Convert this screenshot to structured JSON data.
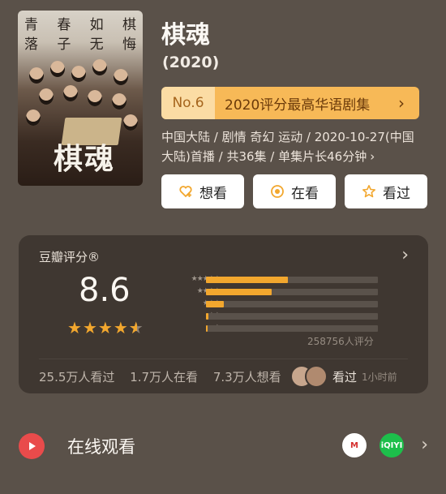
{
  "poster": {
    "poem": [
      [
        "青",
        "春",
        "如",
        "棋"
      ],
      [
        "落",
        "子",
        "无",
        "悔"
      ]
    ],
    "title_art": "棋魂"
  },
  "header": {
    "title": "棋魂",
    "year": "(2020)"
  },
  "ranking": {
    "number": "No.6",
    "text": "2020评分最高华语剧集",
    "chevron": "›"
  },
  "meta": {
    "text": "中国大陆 / 剧情 奇幻 运动 / 2020-10-27(中国大陆)首播 / 共36集 / 单集片长46分钟",
    "chevron": "›"
  },
  "actions": [
    {
      "label": "想看",
      "icon": "heart-plus-icon"
    },
    {
      "label": "在看",
      "icon": "target-circle-icon"
    },
    {
      "label": "看过",
      "icon": "star-outline-icon"
    }
  ],
  "rating": {
    "label": "豆瓣评分®",
    "score": "8.6",
    "stars": 4.3,
    "distribution": [
      {
        "stars": "★★★★★",
        "percent": 47.8
      },
      {
        "stars": "★★★★",
        "percent": 38.0
      },
      {
        "stars": "★★★",
        "percent": 10.5
      },
      {
        "stars": "★★",
        "percent": 1.5
      },
      {
        "stars": "★",
        "percent": 1.0
      }
    ],
    "count": "258756人评分",
    "chevron": "›"
  },
  "stats": {
    "watched": "25.5万人看过",
    "watching": "1.7万人在看",
    "want": "7.3万人想看",
    "friends_seen": "看过",
    "friends_time": "1小时前"
  },
  "watch_online": {
    "label": "在线观看",
    "apps": [
      {
        "icon": "mango-tv-icon",
        "text": "M"
      },
      {
        "icon": "iqiyi-icon",
        "text": "iQIYI"
      }
    ],
    "chevron": "›"
  },
  "colors": {
    "background": "#5a5149",
    "card": "#3f3731",
    "accent_orange": "#f2a72e",
    "rank_badge": "#f7b957",
    "play_red": "#e94b4b",
    "iqiyi_green": "#1dbf4b"
  }
}
